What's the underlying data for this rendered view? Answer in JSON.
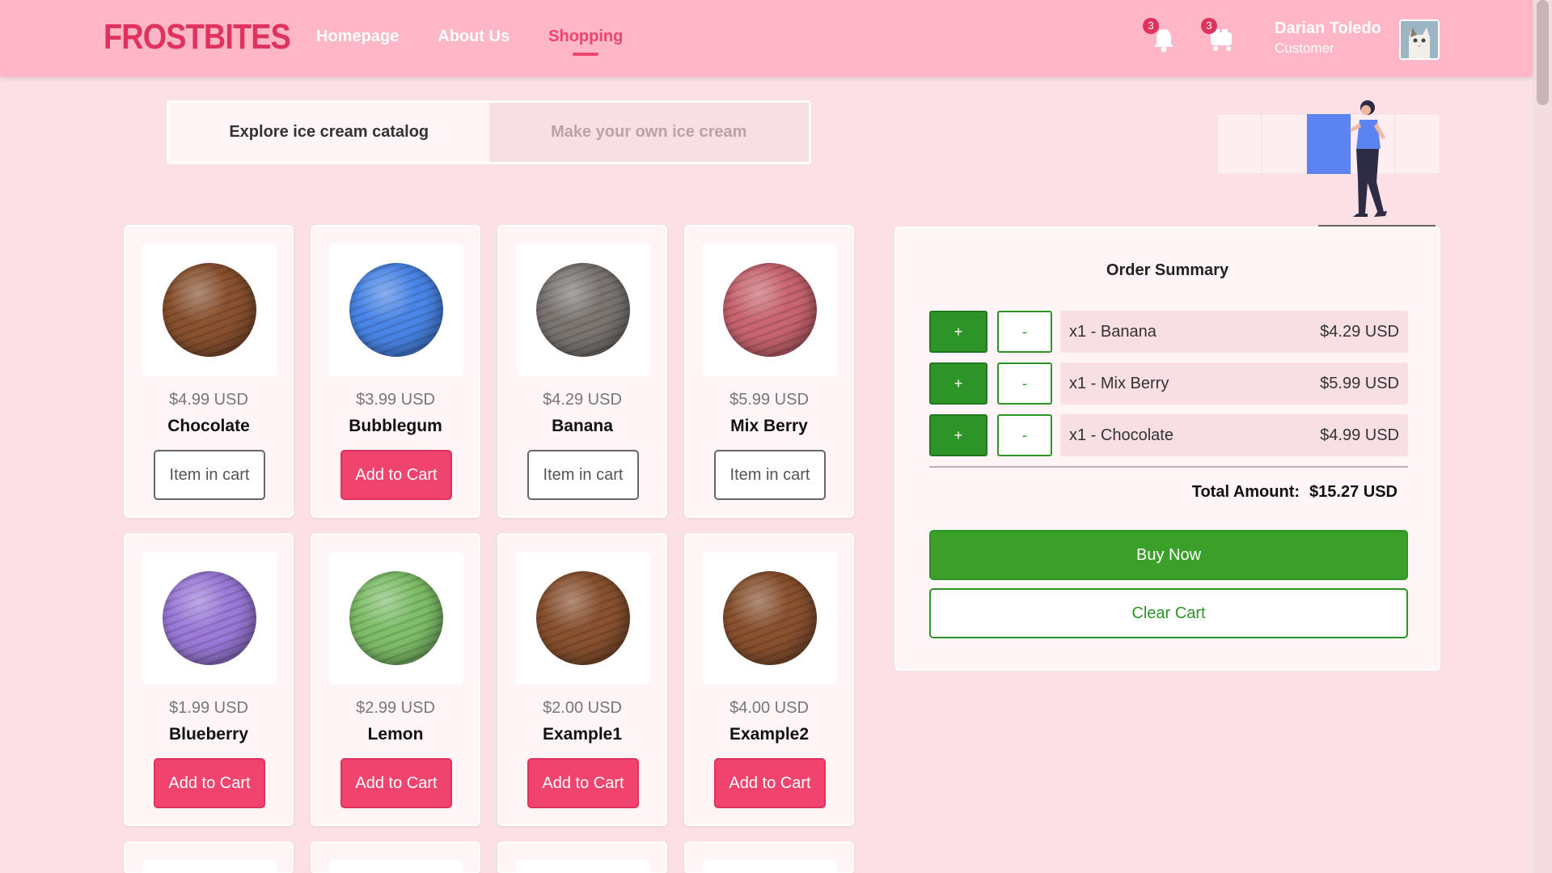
{
  "header": {
    "logo_part1": "FROST",
    "logo_part2": "BITES",
    "nav": [
      {
        "label": "Homepage",
        "active": false
      },
      {
        "label": "About Us",
        "active": false
      },
      {
        "label": "Shopping",
        "active": true
      }
    ],
    "notifications_count": "3",
    "cart_count": "3",
    "user_name": "Darian Toledo",
    "user_role": "Customer"
  },
  "tabs": {
    "catalog": "Explore ice cream catalog",
    "custom": "Make your own ice cream"
  },
  "products": [
    {
      "price": "$4.99 USD",
      "name": "Chocolate",
      "button": "Item in cart",
      "in_cart": true,
      "color": "#8a5230"
    },
    {
      "price": "$3.99 USD",
      "name": "Bubblegum",
      "button": "Add to Cart",
      "in_cart": false,
      "color": "#4a86e8"
    },
    {
      "price": "$4.29 USD",
      "name": "Banana",
      "button": "Item in cart",
      "in_cart": true,
      "color": "#7c7672"
    },
    {
      "price": "$5.99 USD",
      "name": "Mix Berry",
      "button": "Item in cart",
      "in_cart": true,
      "color": "#c96570"
    },
    {
      "price": "$1.99 USD",
      "name": "Blueberry",
      "button": "Add to Cart",
      "in_cart": false,
      "color": "#9b7ad9"
    },
    {
      "price": "$2.99 USD",
      "name": "Lemon",
      "button": "Add to Cart",
      "in_cart": false,
      "color": "#7fbf6a"
    },
    {
      "price": "$2.00 USD",
      "name": "Example1",
      "button": "Add to Cart",
      "in_cart": false,
      "color": "#8a5230"
    },
    {
      "price": "$4.00 USD",
      "name": "Example2",
      "button": "Add to Cart",
      "in_cart": false,
      "color": "#8a5230"
    }
  ],
  "summary": {
    "title": "Order Summary",
    "plus_label": "+",
    "minus_label": "-",
    "items": [
      {
        "label": "x1 - Banana",
        "price": "$4.29 USD"
      },
      {
        "label": "x1 - Mix Berry",
        "price": "$5.99 USD"
      },
      {
        "label": "x1 - Chocolate",
        "price": "$4.99 USD"
      }
    ],
    "total_label": "Total Amount:",
    "total_value": "$15.27 USD",
    "buy_label": "Buy Now",
    "clear_label": "Clear Cart"
  },
  "colors": {
    "header_bg": "#ffb6c6",
    "accent": "#f0446e",
    "green": "#2d9428"
  }
}
